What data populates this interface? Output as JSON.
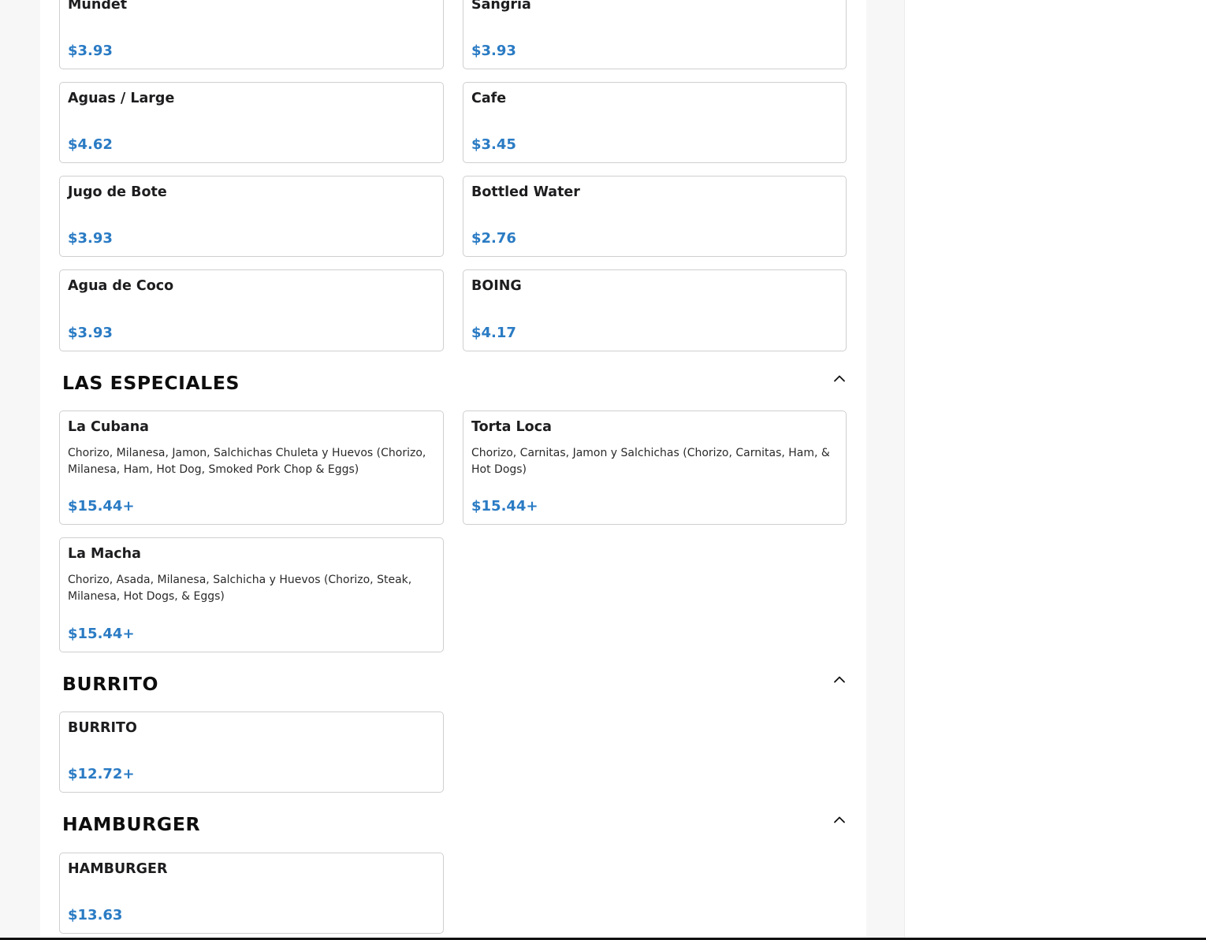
{
  "drinks_items": [
    {
      "name": "Mundet",
      "price": "$3.93"
    },
    {
      "name": "Sangria",
      "price": "$3.93"
    },
    {
      "name": "Aguas / Large",
      "price": "$4.62"
    },
    {
      "name": "Cafe",
      "price": "$3.45"
    },
    {
      "name": "Jugo de Bote",
      "price": "$3.93"
    },
    {
      "name": "Bottled Water",
      "price": "$2.76"
    },
    {
      "name": "Agua de Coco",
      "price": "$3.93"
    },
    {
      "name": "BOING",
      "price": "$4.17"
    }
  ],
  "sections": [
    {
      "title": "LAS ESPECIALES",
      "toggle_icon": "chevron-up-icon",
      "items": [
        {
          "name": "La Cubana",
          "description": "Chorizo, Milanesa, Jamon, Salchichas Chuleta y Huevos (Chorizo, Milanesa, Ham, Hot Dog, Smoked Pork Chop & Eggs)",
          "price": "$15.44+"
        },
        {
          "name": "Torta Loca",
          "description": "Chorizo, Carnitas, Jamon y Salchichas (Chorizo, Carnitas, Ham, & Hot Dogs)",
          "price": "$15.44+"
        },
        {
          "name": "La Macha",
          "description": "Chorizo, Asada, Milanesa, Salchicha y Huevos (Chorizo, Steak, Milanesa, Hot Dogs, & Eggs)",
          "price": "$15.44+"
        }
      ]
    },
    {
      "title": "BURRITO",
      "toggle_icon": "chevron-up-icon",
      "items": [
        {
          "name": "BURRITO",
          "price": "$12.72+"
        }
      ]
    },
    {
      "title": "HAMBURGER",
      "toggle_icon": "chevron-up-icon",
      "items": [
        {
          "name": "HAMBURGER",
          "price": "$13.63"
        }
      ]
    }
  ],
  "colors": {
    "price": "#2a7bc4",
    "card_border": "#cfcfcf",
    "page_background": "#f7f7f7"
  }
}
